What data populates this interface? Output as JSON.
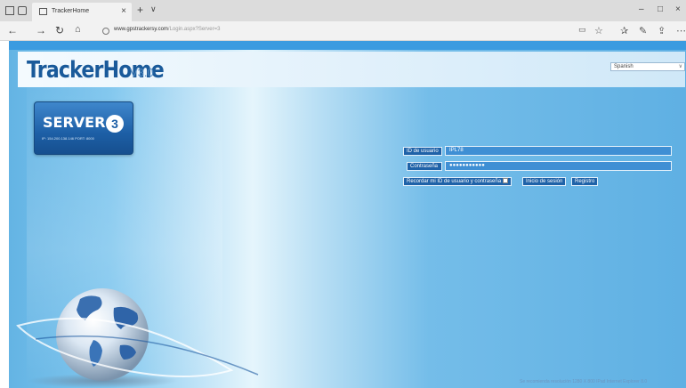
{
  "browser": {
    "tab_title": "TrackerHome",
    "url_host": "www.gpstrackersy.com",
    "url_path": "/Login.aspx?Server=3"
  },
  "page": {
    "logo": "TrackerHome",
    "version": "V3.0",
    "language": "Spanish",
    "server": {
      "title": "SERVER",
      "number": "3",
      "ip_text": "IP: 154.200.138.146     PORT: 8000"
    },
    "login": {
      "user_label": "ID de usuario",
      "user_value": "IPL78",
      "password_label": "Contraseña",
      "password_value": "●●●●●●●●●●●",
      "remember_label": "Recordar mi ID de usuario y contraseña",
      "login_button": "Inicio de sesión",
      "register_button": "Registro"
    },
    "footer": "Se recomienda resolución 1280 X 800 IPad Internet Explorer 8.0"
  },
  "colors": {
    "brand": "#1a5a9a",
    "panel": "#1f62a8",
    "field": "#3f8fd4"
  }
}
